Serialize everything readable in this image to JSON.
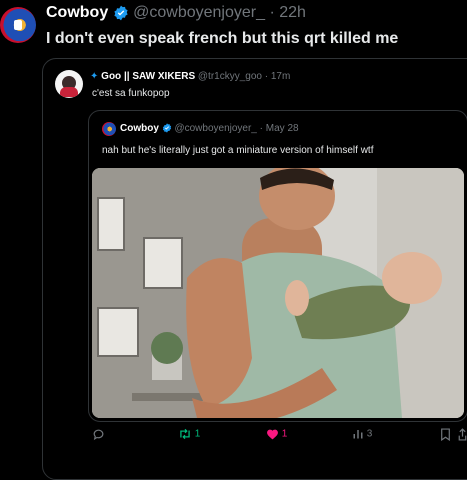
{
  "outer_tweet": {
    "display_name": "Cowboy",
    "handle": "@cowboyenjoyer_",
    "dot": "·",
    "time": "22h",
    "text": "I don't even speak french but this qrt killed me"
  },
  "quote_tweet": {
    "display_name": "Goo || SAW XIKERS",
    "handle": "@tr1ckyy_goo",
    "dot": "·",
    "time": "17m",
    "text": "c'est sa funkopop"
  },
  "nested_quote": {
    "display_name": "Cowboy",
    "handle": "@cowboyenjoyer_",
    "dot": "·",
    "time": "May 28",
    "text": "nah but he's literally just got a miniature version of himself wtf"
  },
  "actions": {
    "retweet_count": "1",
    "like_count": "1",
    "views_count": "3"
  },
  "colors": {
    "accent": "#1d9bf0",
    "like": "#f91880",
    "retweet": "#00ba7c",
    "muted": "#71767b",
    "border": "#2f3336"
  },
  "icons": {
    "verified": "verified-badge-icon",
    "reply": "reply-icon",
    "retweet": "retweet-icon",
    "like": "heart-icon",
    "views": "views-icon",
    "bookmark": "bookmark-icon",
    "share": "share-icon"
  }
}
